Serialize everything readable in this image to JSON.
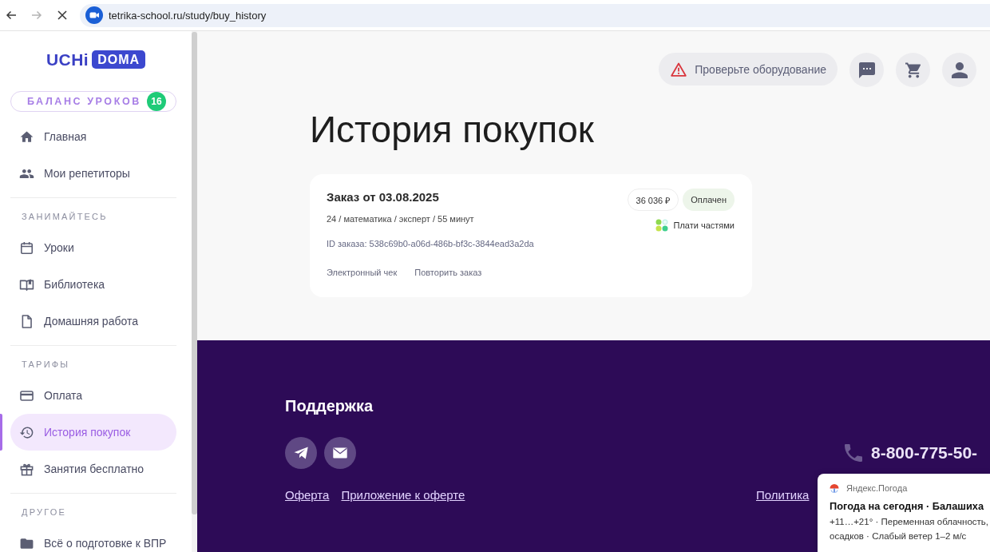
{
  "browser": {
    "url": "tetrika-school.ru/study/buy_history",
    "forward_disabled": true
  },
  "sidebar": {
    "logo": {
      "wordmark": "UCHi",
      "badge": "DOMA"
    },
    "balance": {
      "label": "БАЛАНС УРОКОВ",
      "count": "16"
    },
    "sections": [
      {
        "items": [
          {
            "label": "Главная",
            "selected": false
          },
          {
            "label": "Мои репетиторы",
            "selected": false
          }
        ]
      },
      {
        "title": "ЗАНИМАЙТЕСЬ",
        "items": [
          {
            "label": "Уроки",
            "selected": false
          },
          {
            "label": "Библиотека",
            "selected": false
          },
          {
            "label": "Домашняя работа",
            "selected": false
          }
        ]
      },
      {
        "title": "ТАРИФЫ",
        "items": [
          {
            "label": "Оплата",
            "selected": false
          },
          {
            "label": "История покупок",
            "selected": true
          },
          {
            "label": "Занятия бесплатно",
            "selected": false
          }
        ]
      },
      {
        "title": "ДРУГОЕ",
        "items": [
          {
            "label": "Всё о подготовке к ВПР",
            "selected": false
          }
        ]
      }
    ]
  },
  "header": {
    "equipment_check": "Проверьте оборудование"
  },
  "page_title": "История покупок",
  "orders": [
    {
      "title": "Заказ от 03.08.2025",
      "details": "24 / математика / эксперт / 55 минут",
      "order_id": "ID заказа: 538c69b0-a06d-486b-bf3c-3844ead3a2da",
      "price": "36 036 ₽",
      "status": "Оплачен",
      "installments": "Плати частями",
      "actions": [
        "Электронный чек",
        "Повторить заказ"
      ]
    }
  ],
  "footer": {
    "title": "Поддержка",
    "links": [
      "Оферта",
      "Приложение к оферте"
    ],
    "phone": "8-800-775-50-",
    "policy_link": "Политика"
  },
  "notification": {
    "source": "Яндекс.Погода",
    "title": "Погода на сегодня · Балашиха",
    "lines": [
      "+11…+21° · Переменная облачность,",
      "осадков · Слабый ветер 1–2 м/с"
    ]
  }
}
